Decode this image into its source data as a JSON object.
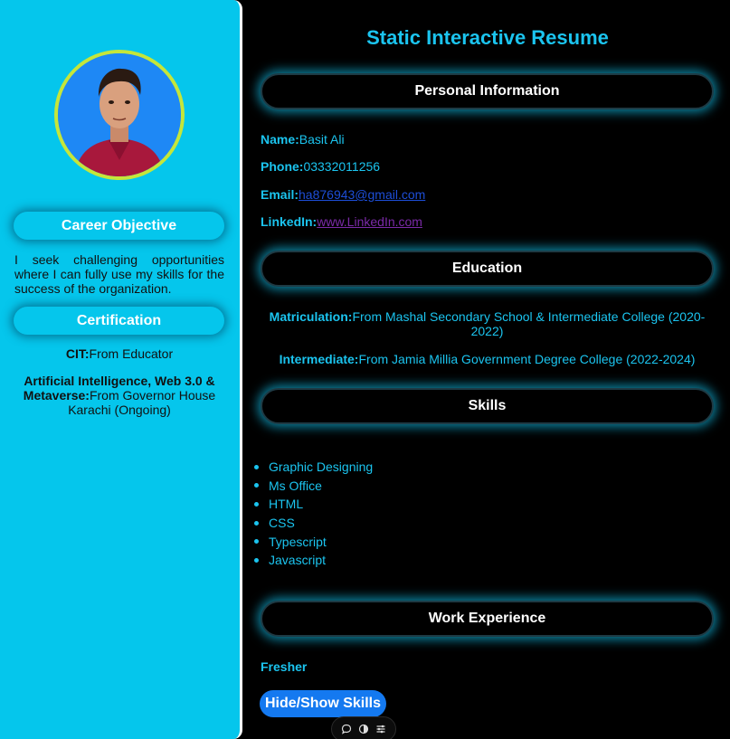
{
  "sidebar": {
    "career_objective": {
      "heading": "Career Objective",
      "text": "I seek challenging opportunities where I can fully use my skills for the success of the organization."
    },
    "certification": {
      "heading": "Certification",
      "items": [
        {
          "label": "CIT:",
          "value": "From Educator"
        },
        {
          "label": "Artificial Intelligence, Web 3.0 & Metaverse:",
          "value": "From Governor House Karachi (Ongoing)"
        }
      ]
    }
  },
  "main": {
    "title": "Static Interactive Resume",
    "personal": {
      "heading": "Personal Information",
      "name_label": "Name:",
      "name": "Basit Ali",
      "phone_label": "Phone:",
      "phone": "03332011256",
      "email_label": "Email:",
      "email": "ha876943@gmail.com",
      "linkedin_label": "LinkedIn:",
      "linkedin": "www.LinkedIn.com"
    },
    "education": {
      "heading": "Education",
      "items": [
        {
          "label": "Matriculation:",
          "value": "From Mashal Secondary School & Intermediate College (2020-2022)"
        },
        {
          "label": "Intermediate:",
          "value": "From Jamia Millia Government Degree College (2022-2024)"
        }
      ]
    },
    "skills": {
      "heading": "Skills",
      "items": [
        "Graphic Designing",
        "Ms Office",
        "HTML",
        "CSS",
        "Typescript",
        "Javascript"
      ]
    },
    "work": {
      "heading": "Work Experience",
      "text": "Fresher"
    },
    "toggle_button": "Hide/Show Skills"
  },
  "toolbar": {
    "icons": [
      "comment-icon",
      "toggle-icon",
      "settings-sliders-icon"
    ]
  },
  "colors": {
    "sidebar_bg": "#05c6ec",
    "accent_text": "#1bc4ef",
    "glow": "#10b4dc",
    "button_bg": "#1479f0",
    "photo_ring": "#c5e63a"
  }
}
